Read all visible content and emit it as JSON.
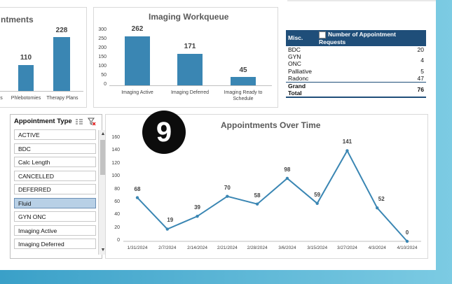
{
  "left_chart": {
    "title_fragment": "ntments",
    "bars": [
      {
        "label": "Phlebotomies",
        "value": 110
      },
      {
        "label": "Therapy Plans",
        "value": 228
      }
    ],
    "cut_label": "s"
  },
  "workqueue": {
    "title": "Imaging Workqueue",
    "y_ticks": [
      "300",
      "250",
      "200",
      "150",
      "100",
      "50",
      "0"
    ],
    "bars": [
      {
        "label": "Imaging Active",
        "value": 262
      },
      {
        "label": "Imaging Deferred",
        "value": 171
      },
      {
        "label": "Imaging Ready to Schedule",
        "value": 45
      }
    ]
  },
  "pivot": {
    "header_left": "Misc.",
    "header_right": "Number of Appointment Requests",
    "rows": [
      {
        "name": "BDC",
        "value": "20"
      },
      {
        "name": "GYN ONC",
        "value": "4"
      },
      {
        "name": "Palliative",
        "value": "5"
      },
      {
        "name": "Radonc",
        "value": "47"
      }
    ],
    "total_label": "Grand Total",
    "total_value": "76"
  },
  "slicer": {
    "title": "Appointment Type",
    "items": [
      "ACTIVE",
      "BDC",
      "Calc Length",
      "CANCELLED",
      "DEFERRED",
      "Fluid",
      "GYN ONC",
      "Imaging Active",
      "Imaging Deferred"
    ],
    "selected": "Fluid"
  },
  "badge": {
    "number": "9"
  },
  "chart_data": {
    "type": "line",
    "title": "Appointments Over Time",
    "x": [
      "1/31/2024",
      "2/7/2024",
      "2/14/2024",
      "2/21/2024",
      "2/28/2024",
      "3/6/2024",
      "3/15/2024",
      "3/27/2024",
      "4/3/2024",
      "4/10/2024"
    ],
    "values": [
      68,
      19,
      39,
      70,
      58,
      98,
      59,
      141,
      52,
      0
    ],
    "y_ticks": [
      "160",
      "140",
      "120",
      "100",
      "80",
      "60",
      "40",
      "20",
      "0"
    ],
    "ylim": [
      0,
      160
    ],
    "color": "#3a86b3"
  }
}
